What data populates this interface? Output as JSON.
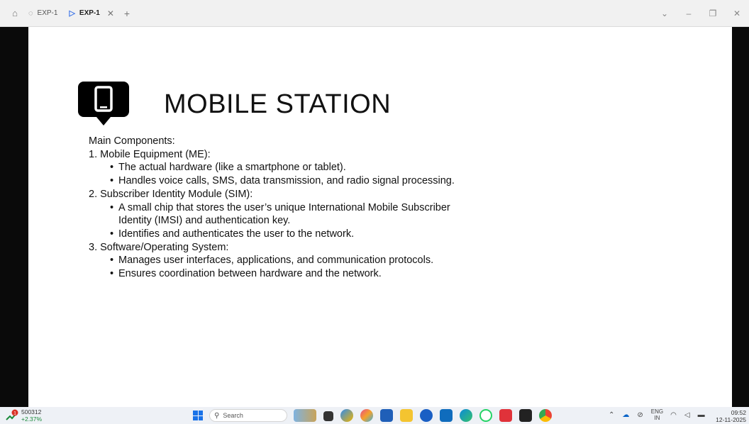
{
  "tabs": [
    {
      "label": "EXP-1",
      "active": false
    },
    {
      "label": "EXP-1",
      "active": true
    }
  ],
  "slide": {
    "title": "MOBILE STATION",
    "heading": "Main Components:",
    "item1": "1. Mobile Equipment (ME):",
    "item1_b1": "The actual hardware (like a smartphone or tablet).",
    "item1_b2": "Handles voice calls, SMS, data transmission, and radio signal processing.",
    "item2": "2. Subscriber Identity Module (SIM):",
    "item2_b1a": "A small chip that stores the user’s unique International Mobile Subscriber",
    "item2_b1b": "Identity (IMSI) and authentication key.",
    "item2_b2": "Identifies and authenticates the user to the network.",
    "item3": "3. Software/Operating System:",
    "item3_b1": "Manages user interfaces, applications, and communication protocols.",
    "item3_b2": "Ensures coordination between hardware and the network.",
    "bullet": "•"
  },
  "taskbar": {
    "stock_value": "500312",
    "stock_change": "+2.37%",
    "badge": "1",
    "search_placeholder": "Search",
    "lang_top": "ENG",
    "lang_bottom": "IN",
    "time": "09:52",
    "date": "12-11-2025"
  },
  "colors": {
    "accent": "#1a73e8",
    "stock_up": "#1a8a3a"
  }
}
